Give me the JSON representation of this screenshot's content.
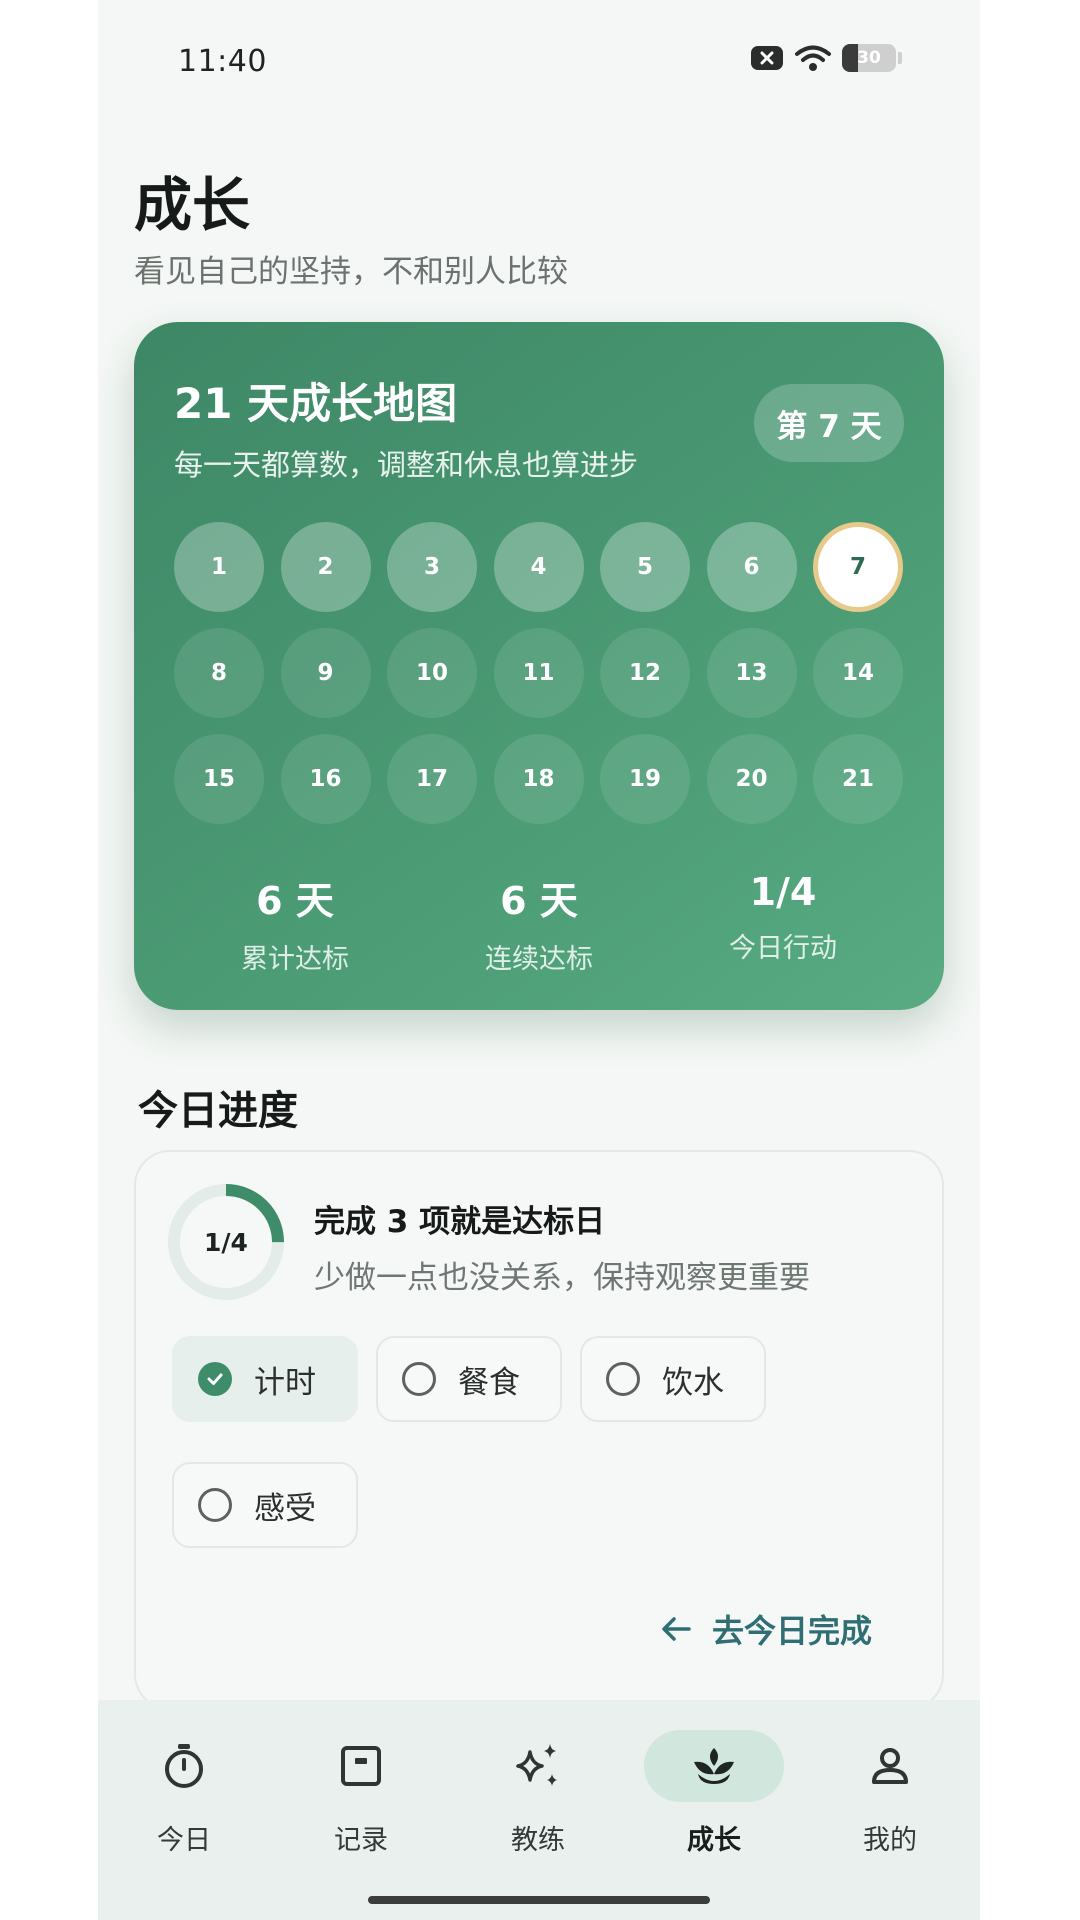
{
  "status_bar": {
    "time": "11:40",
    "battery": "30",
    "battery_level": 0.3
  },
  "header": {
    "title": "成长",
    "subtitle": "看见自己的坚持，不和别人比较"
  },
  "map_card": {
    "title": "21 天成长地图",
    "subtitle": "每一天都算数，调整和休息也算进步",
    "day_chip": "第 7 天",
    "days": [
      "1",
      "2",
      "3",
      "4",
      "5",
      "6",
      "7",
      "8",
      "9",
      "10",
      "11",
      "12",
      "13",
      "14",
      "15",
      "16",
      "17",
      "18",
      "19",
      "20",
      "21"
    ],
    "current_day": 7,
    "stats": [
      {
        "value": "6 天",
        "label": "累计达标"
      },
      {
        "value": "6 天",
        "label": "连续达标"
      },
      {
        "value": "1/4",
        "label": "今日行动"
      }
    ]
  },
  "today": {
    "section_title": "今日进度",
    "ring_label": "1/4",
    "progress": 0.25,
    "goal_title": "完成 3 项就是达标日",
    "goal_subtitle": "少做一点也没关系，保持观察更重要",
    "tasks": [
      {
        "label": "计时",
        "checked": true
      },
      {
        "label": "餐食",
        "checked": false
      },
      {
        "label": "饮水",
        "checked": false
      },
      {
        "label": "感受",
        "checked": false
      }
    ],
    "go_link": "去今日完成"
  },
  "nav": {
    "items": [
      {
        "label": "今日",
        "icon": "stopwatch-icon"
      },
      {
        "label": "记录",
        "icon": "record-icon"
      },
      {
        "label": "教练",
        "icon": "sparkle-icon"
      },
      {
        "label": "成长",
        "icon": "sprout-icon",
        "active": true
      },
      {
        "label": "我的",
        "icon": "person-icon"
      }
    ]
  },
  "colors": {
    "brand": "#3f8c6a",
    "accent_ring": "#e6c98b",
    "link": "#2f6f73"
  }
}
